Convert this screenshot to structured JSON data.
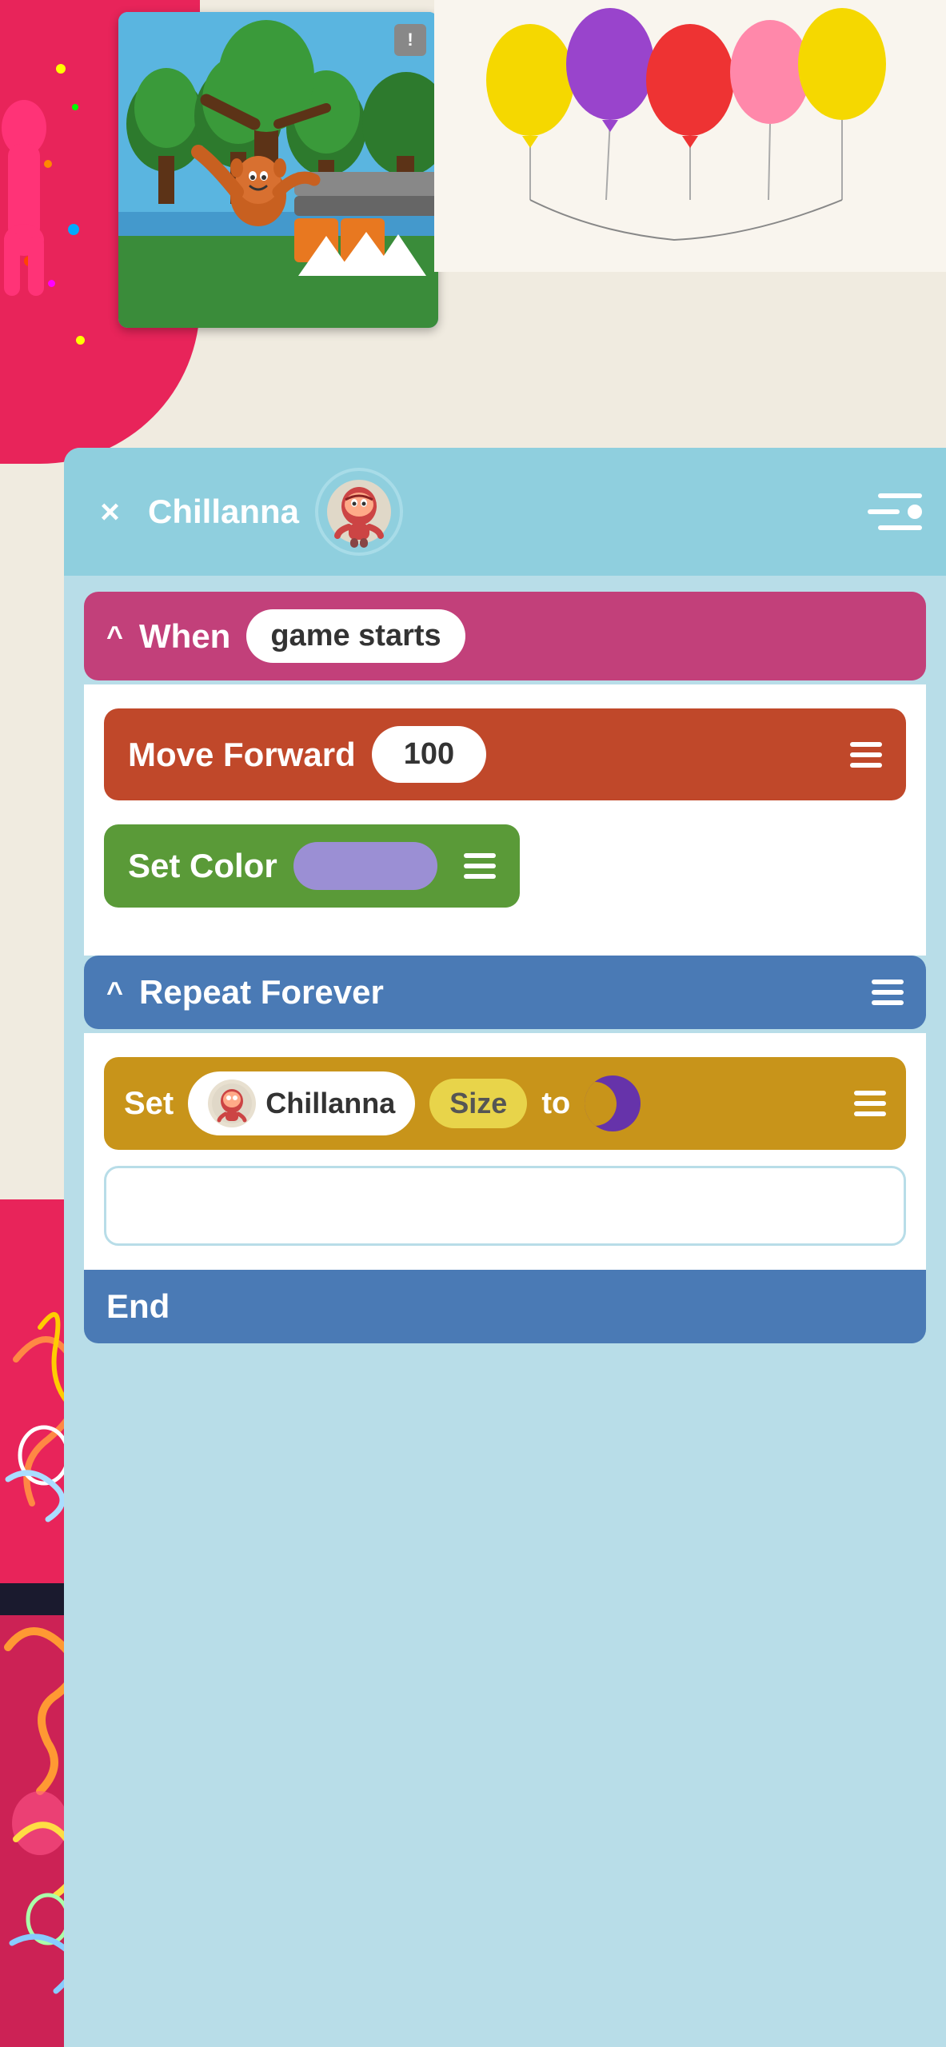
{
  "header": {
    "title": "Chillanna",
    "close_label": "×",
    "menu_icon": "menu-icon"
  },
  "when_block": {
    "label": "When",
    "trigger": "game starts",
    "chevron": "^"
  },
  "move_forward_block": {
    "label": "Move Forward",
    "value": "100"
  },
  "set_color_block": {
    "label": "Set Color"
  },
  "repeat_forever_block": {
    "label": "Repeat Forever",
    "chevron": "^"
  },
  "set_size_block": {
    "set_label": "Set",
    "character_name": "Chillanna",
    "size_label": "Size",
    "to_label": "to"
  },
  "end_block": {
    "label": "End"
  },
  "warning": "!",
  "colors": {
    "header_bg": "#8fcfde",
    "when_bg": "#c2407a",
    "move_forward_bg": "#c0482a",
    "set_color_bg": "#5a9a38",
    "repeat_bg": "#4a7ab5",
    "set_size_bg": "#c8941a",
    "color_swatch": "#9b8fd4"
  }
}
